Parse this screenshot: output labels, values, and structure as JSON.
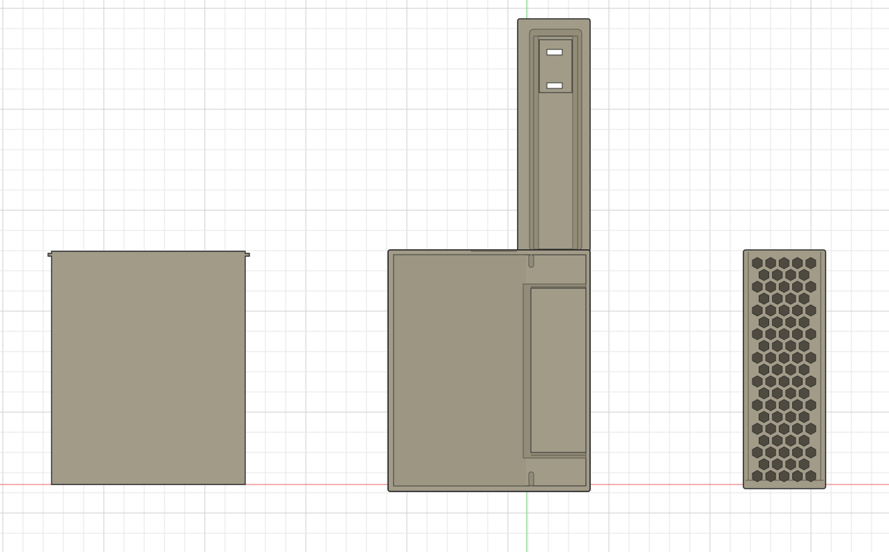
{
  "canvas": {
    "background": "#ffffff",
    "grid_minor_color": "#e6e6e6",
    "grid_major_color": "#cdcdcd",
    "x_axis_color": "#e98080",
    "y_axis_color": "#7ed07e"
  },
  "model": {
    "body_fill": "#a19b88",
    "body_fill_dark": "#928c79",
    "edge_color": "#2b2b2b",
    "inner_edge_color": "#5a564b",
    "cutout_fill": "#ffffff"
  },
  "parts": [
    {
      "id": "panel-left",
      "description_visible": false
    },
    {
      "id": "box-center",
      "description_visible": false
    },
    {
      "id": "grille-right",
      "description_visible": false
    }
  ],
  "status": {
    "selection_text": ""
  }
}
